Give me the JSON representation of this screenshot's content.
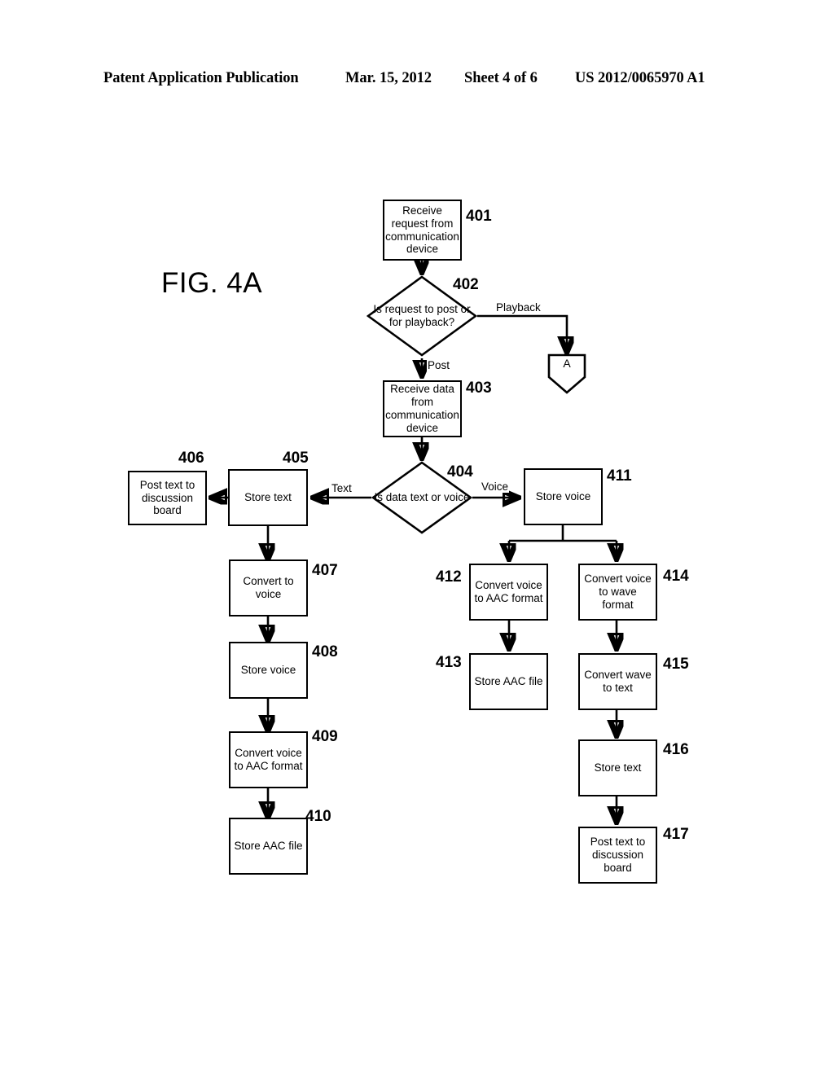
{
  "header": {
    "publication": "Patent Application Publication",
    "date": "Mar. 15, 2012",
    "sheet": "Sheet 4 of 6",
    "patent_number": "US 2012/0065970 A1"
  },
  "figure": {
    "label": "FIG. 4A"
  },
  "nodes": {
    "n401": {
      "ref": "401",
      "text": "Receive request from communication device",
      "shape": "process"
    },
    "n402": {
      "ref": "402",
      "text": "Is request to post or for playback?",
      "shape": "decision"
    },
    "n403": {
      "ref": "403",
      "text": "Receive data from communication device",
      "shape": "process"
    },
    "n404": {
      "ref": "404",
      "text": "Is data text or voice",
      "shape": "decision"
    },
    "n405": {
      "ref": "405",
      "text": "Store text",
      "shape": "process"
    },
    "n406": {
      "ref": "406",
      "text": "Post text to discussion board",
      "shape": "process"
    },
    "n407": {
      "ref": "407",
      "text": "Convert to voice",
      "shape": "process"
    },
    "n408": {
      "ref": "408",
      "text": "Store voice",
      "shape": "process"
    },
    "n409": {
      "ref": "409",
      "text": "Convert voice to AAC format",
      "shape": "process"
    },
    "n410": {
      "ref": "410",
      "text": "Store AAC file",
      "shape": "process"
    },
    "n411": {
      "ref": "411",
      "text": "Store voice",
      "shape": "process"
    },
    "n412": {
      "ref": "412",
      "text": "Convert voice to AAC format",
      "shape": "process"
    },
    "n413": {
      "ref": "413",
      "text": "Store AAC file",
      "shape": "process"
    },
    "n414": {
      "ref": "414",
      "text": "Convert voice to wave format",
      "shape": "process"
    },
    "n415": {
      "ref": "415",
      "text": "Convert wave to text",
      "shape": "process"
    },
    "n416": {
      "ref": "416",
      "text": "Store text",
      "shape": "process"
    },
    "n417": {
      "ref": "417",
      "text": "Post text to discussion board",
      "shape": "process"
    },
    "connectorA": {
      "text": "A",
      "shape": "offpage-connector"
    }
  },
  "edge_labels": {
    "playback": "Playback",
    "post": "Post",
    "text": "Text",
    "voice": "Voice"
  },
  "colors": {
    "ink": "#000000",
    "paper": "#ffffff"
  }
}
